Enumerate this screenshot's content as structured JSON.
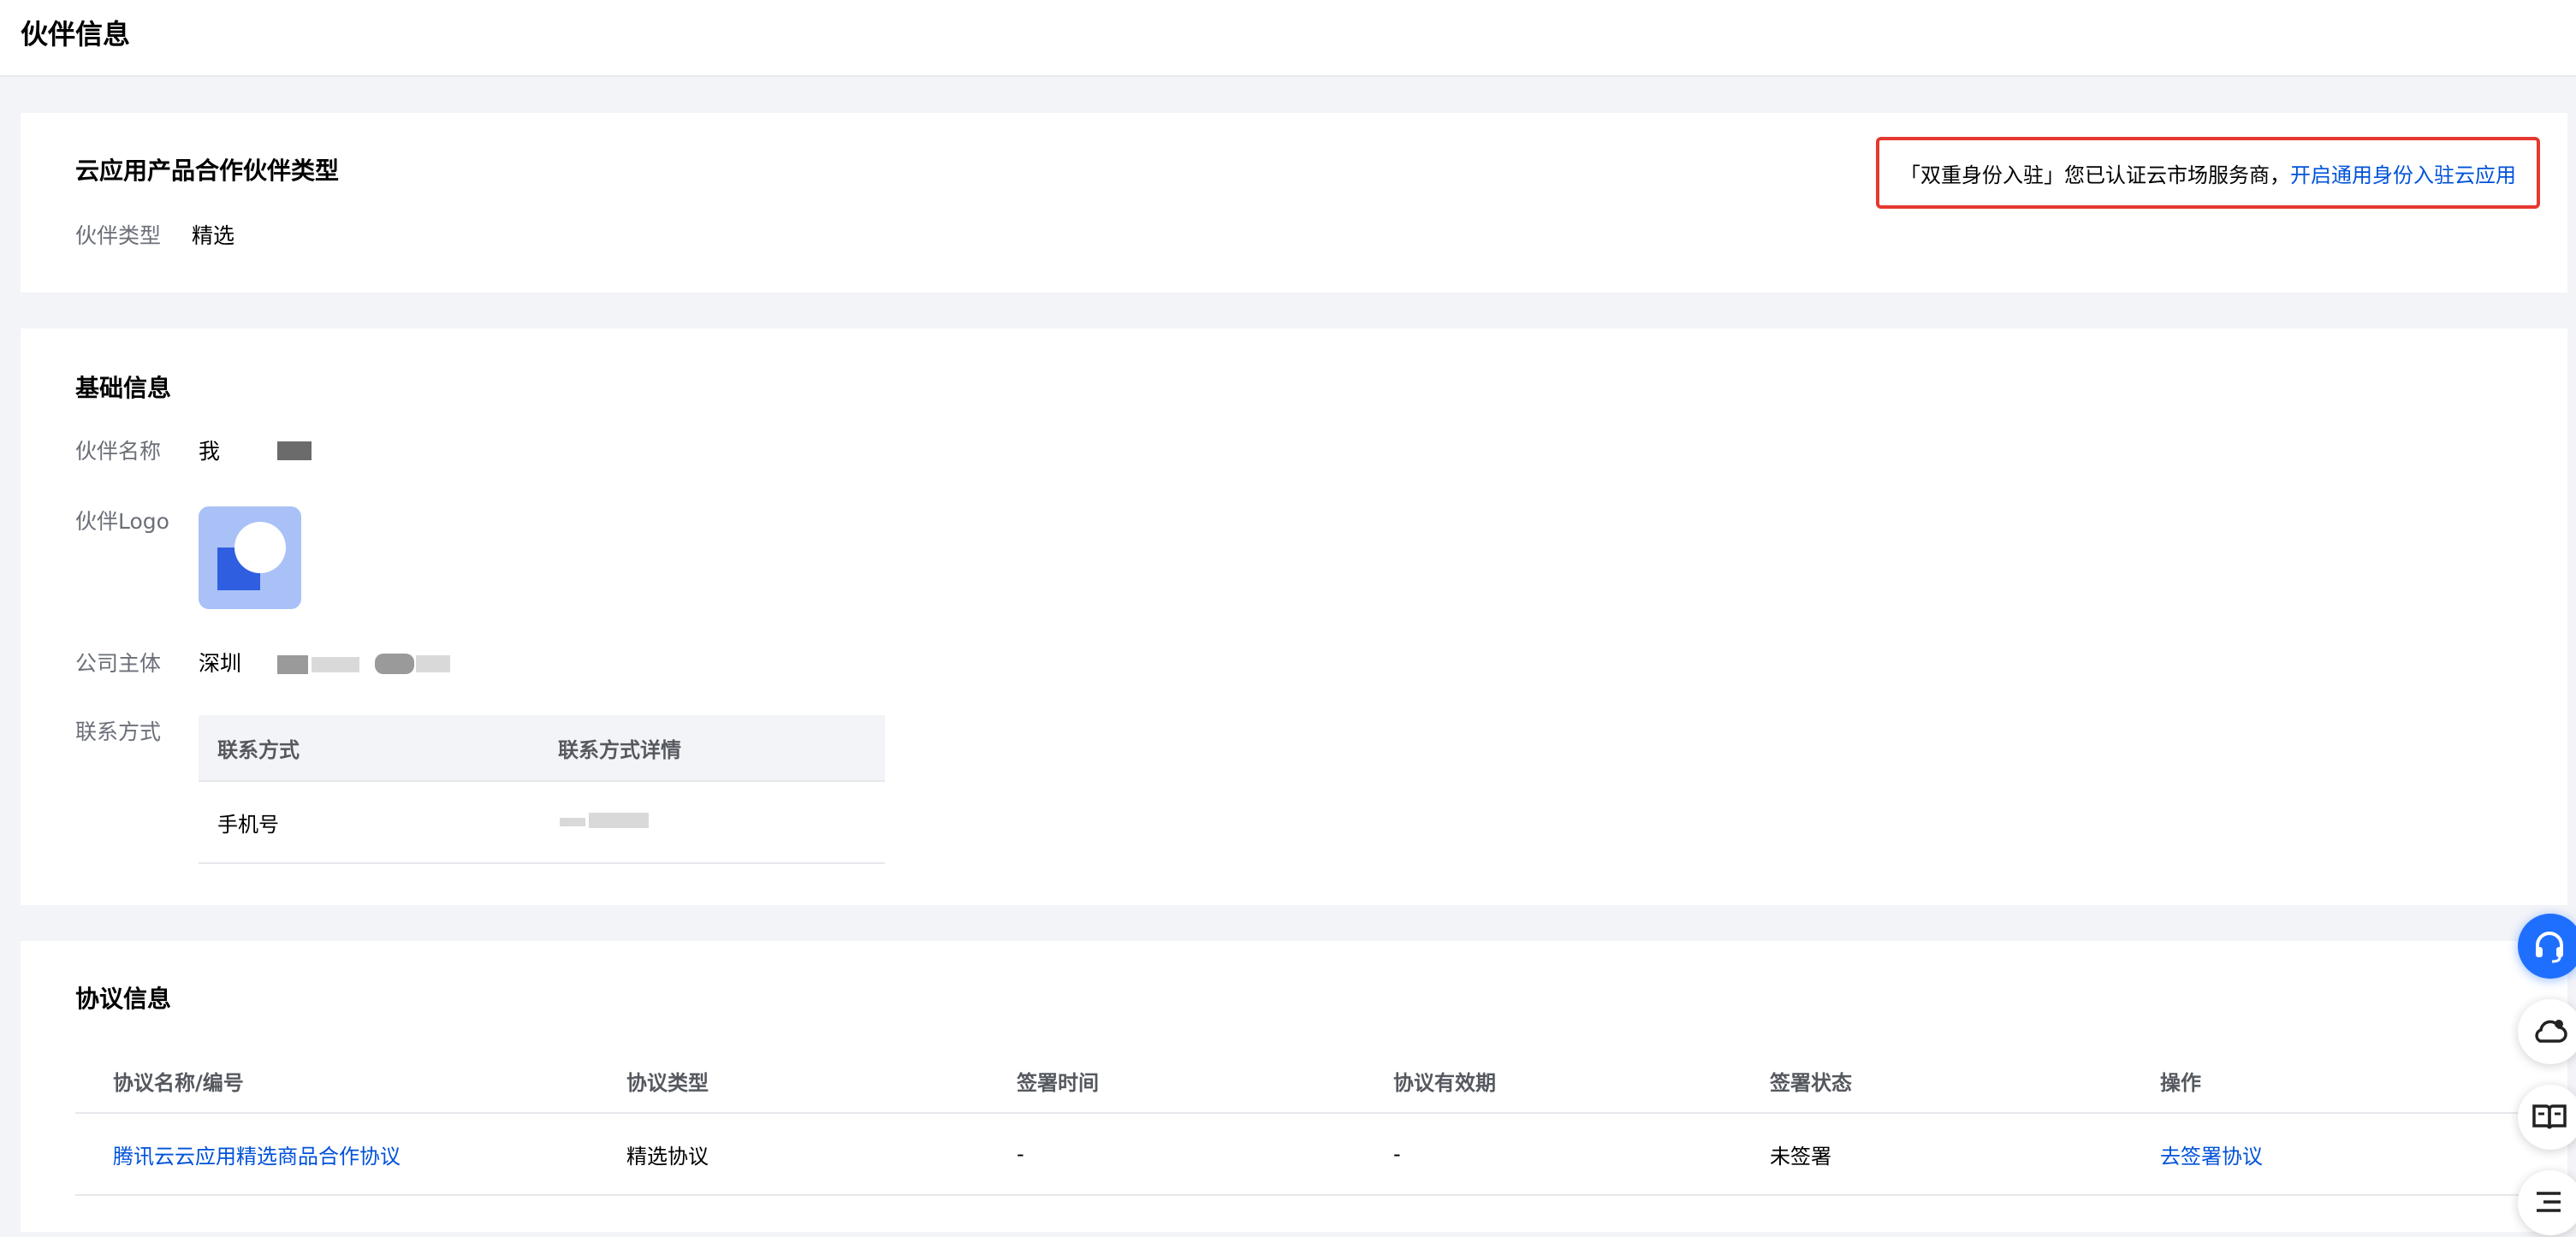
{
  "page": {
    "title": "伙伴信息"
  },
  "partner_type_section": {
    "title": "云应用产品合作伙伴类型",
    "label": "伙伴类型",
    "value": "精选",
    "notice": {
      "text": "「双重身份入驻」您已认证云市场服务商，",
      "link": "开启通用身份入驻云应用",
      "border_color": "#e5382f"
    }
  },
  "basic_info": {
    "title": "基础信息",
    "name_label": "伙伴名称",
    "name_value": "我",
    "logo_label": "伙伴Logo",
    "company_label": "公司主体",
    "company_value": "深圳",
    "contact_label": "联系方式",
    "contact_table": {
      "headers": [
        "联系方式",
        "联系方式详情"
      ],
      "rows": [
        {
          "type": "手机号",
          "detail": ""
        }
      ]
    }
  },
  "agreement_info": {
    "title": "协议信息",
    "headers": [
      "协议名称/编号",
      "协议类型",
      "签署时间",
      "协议有效期",
      "签署状态",
      "操作"
    ],
    "rows": [
      {
        "name": "腾讯云云应用精选商品合作协议",
        "type": "精选协议",
        "sign_time": "-",
        "validity": "-",
        "status": "未签署",
        "action": "去签署协议"
      }
    ]
  },
  "floating_tools": [
    {
      "icon": "headset-icon"
    },
    {
      "icon": "cloud-icon"
    },
    {
      "icon": "book-icon"
    },
    {
      "icon": "list-icon"
    }
  ],
  "colors": {
    "link": "#0052d9",
    "accent": "#1f6fff",
    "background": "#f3f4f7"
  }
}
